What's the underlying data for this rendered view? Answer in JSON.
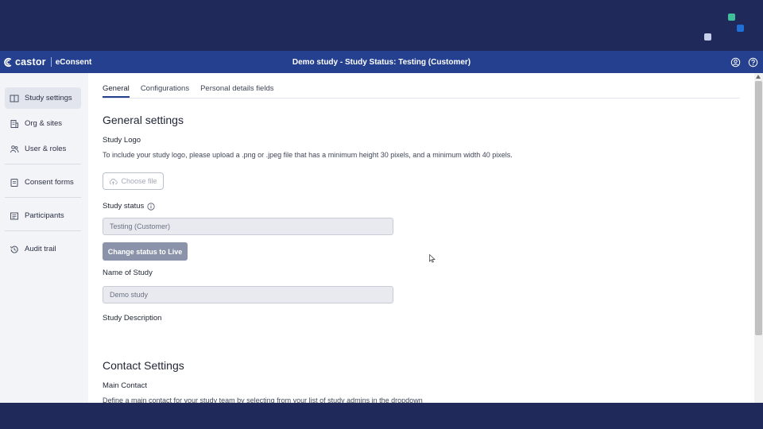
{
  "brand": {
    "name": "castor",
    "product": "eConsent"
  },
  "header": {
    "title": "Demo study  - Study Status: Testing (Customer)",
    "icons": [
      "user-circle-icon",
      "help-icon"
    ]
  },
  "sidebar": {
    "items": [
      {
        "label": "Study settings",
        "icon": "book-icon",
        "active": true
      },
      {
        "label": "Org & sites",
        "icon": "building-icon"
      },
      {
        "label": "User & roles",
        "icon": "users-icon"
      },
      {
        "label": "Consent forms",
        "icon": "document-icon"
      },
      {
        "label": "Participants",
        "icon": "id-card-icon"
      },
      {
        "label": "Audit trail",
        "icon": "history-icon"
      }
    ]
  },
  "tabs": [
    {
      "label": "General",
      "active": true
    },
    {
      "label": "Configurations"
    },
    {
      "label": "Personal details fields"
    }
  ],
  "general": {
    "title": "General settings",
    "logo_label": "Study Logo",
    "logo_help": "To include your study logo, please upload a .png or .jpeg file that has a minimum height 30 pixels, and a minimum width 40 pixels.",
    "choose_file": "Choose file",
    "status_label": "Study status",
    "status_value": "Testing (Customer)",
    "status_button": "Change status to Live",
    "name_label": "Name of Study",
    "name_value": "Demo study",
    "description_label": "Study Description"
  },
  "contact": {
    "title": "Contact Settings",
    "main_label": "Main Contact",
    "main_help": "Define a main contact for your study team by selecting from your list of study admins in the dropdown"
  },
  "colors": {
    "navy": "#1f2a5a",
    "appbar": "#24408e",
    "accent_green": "#3fbf9a",
    "accent_blue": "#1f6fd6",
    "button_disabled": "#8a93a9"
  }
}
